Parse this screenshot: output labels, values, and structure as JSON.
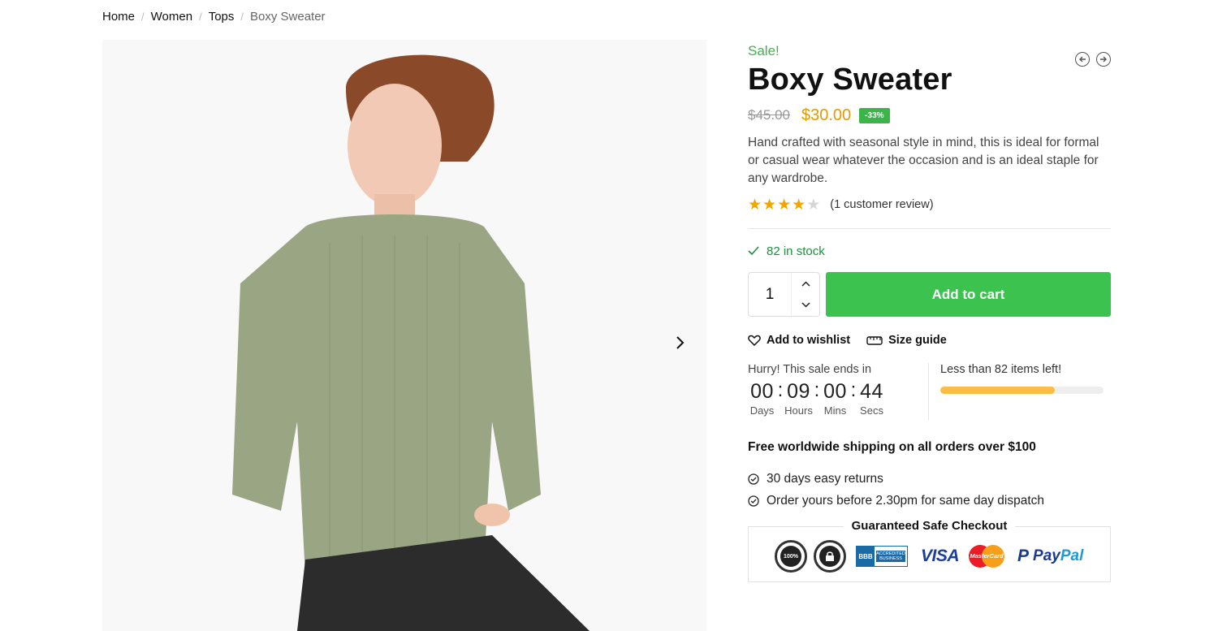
{
  "breadcrumb": {
    "items": [
      "Home",
      "Women",
      "Tops"
    ],
    "current": "Boxy Sweater"
  },
  "product": {
    "sale_flag": "Sale!",
    "title": "Boxy Sweater",
    "price_old": "$45.00",
    "price_new": "$30.00",
    "discount": "-33%",
    "description": "Hand crafted with seasonal style in mind, this is ideal for formal or casual wear whatever the occasion and is an ideal staple for any wardrobe.",
    "rating": 4,
    "rating_max": 5,
    "review_text": "(1 customer review)",
    "stock_text": "82 in stock"
  },
  "cart": {
    "quantity": "1",
    "add_label": "Add to cart"
  },
  "links": {
    "wishlist": "Add to wishlist",
    "size_guide": "Size guide"
  },
  "countdown": {
    "label": "Hurry! This sale ends in",
    "days": "00",
    "hours": "09",
    "mins": "00",
    "secs": "44",
    "days_label": "Days",
    "hours_label": "Hours",
    "mins_label": "Mins",
    "secs_label": "Secs"
  },
  "stock_meter": {
    "label": "Less than 82 items left!",
    "fill_fraction": 0.7
  },
  "shipping": {
    "headline": "Free worldwide shipping on all orders over $100",
    "benefits": [
      "30 days easy returns",
      "Order yours before 2.30pm for same day dispatch"
    ]
  },
  "checkout": {
    "title": "Guaranteed Safe Checkout",
    "seal1": "100%",
    "bbb_left": "BBB",
    "bbb_right": "ACCREDITED BUSINESS",
    "visa": "VISA",
    "mastercard": "MasterCard",
    "paypal_1": "Pay",
    "paypal_2": "Pal"
  },
  "colors": {
    "accent_green": "#3cc24f",
    "price_orange": "#e59a00",
    "stock_green": "#1e8e3e",
    "meter_yellow": "#fbbd43"
  }
}
